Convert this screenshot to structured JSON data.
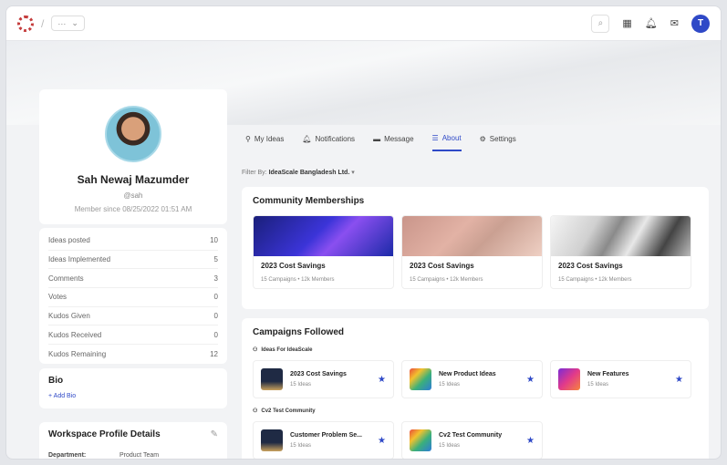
{
  "topbar": {
    "separator": "/",
    "workspace_dots": "···",
    "workspace_chevron": "⌄",
    "search_icon": "⌕",
    "avatar_letter": "T"
  },
  "profile": {
    "name": "Sah Newaj Mazumder",
    "handle": "@sah",
    "member_since": "Member since 08/25/2022 01:51 AM"
  },
  "stats": [
    {
      "label": "Ideas posted",
      "value": "10"
    },
    {
      "label": "Ideas Implemented",
      "value": "5"
    },
    {
      "label": "Comments",
      "value": "3"
    },
    {
      "label": "Votes",
      "value": "0"
    },
    {
      "label": "Kudos Given",
      "value": "0"
    },
    {
      "label": "Kudos Received",
      "value": "0"
    },
    {
      "label": "Kudos Remaining",
      "value": "12"
    }
  ],
  "bio": {
    "title": "Bio",
    "add": "+ Add Bio"
  },
  "workspace_details": {
    "title": "Workspace Profile Details",
    "department_label": "Department:",
    "department_value": "Product Team"
  },
  "tabs": [
    "My Ideas",
    "Notifications",
    "Message",
    "About",
    "Settings"
  ],
  "filter": {
    "label": "Filter By:",
    "value": "IdeaScale Bangladesh Ltd."
  },
  "community": {
    "title": "Community Memberships",
    "cards": [
      {
        "name": "2023 Cost Savings",
        "campaigns": "15 Campaigns",
        "members": "12k Members"
      },
      {
        "name": "2023 Cost Savings",
        "campaigns": "15 Campaigns",
        "members": "12k Members"
      },
      {
        "name": "2023 Cost Savings",
        "campaigns": "15 Campaigns",
        "members": "12k Members"
      }
    ]
  },
  "campaigns": {
    "title": "Campaigns Followed",
    "group1": {
      "name": "Ideas For IdeaScale"
    },
    "group1_cards": [
      {
        "name": "2023 Cost Savings",
        "meta": "15 Ideas"
      },
      {
        "name": "New Product Ideas",
        "meta": "15 Ideas"
      },
      {
        "name": "New Features",
        "meta": "15 Ideas"
      }
    ],
    "group2": {
      "name": "Cv2 Test Community"
    },
    "group2_cards": [
      {
        "name": "Customer Problem Se...",
        "meta": "15 Ideas"
      },
      {
        "name": "Cv2 Test Community",
        "meta": "15 Ideas"
      }
    ]
  },
  "colors": {
    "accent": "#2f49c7"
  }
}
